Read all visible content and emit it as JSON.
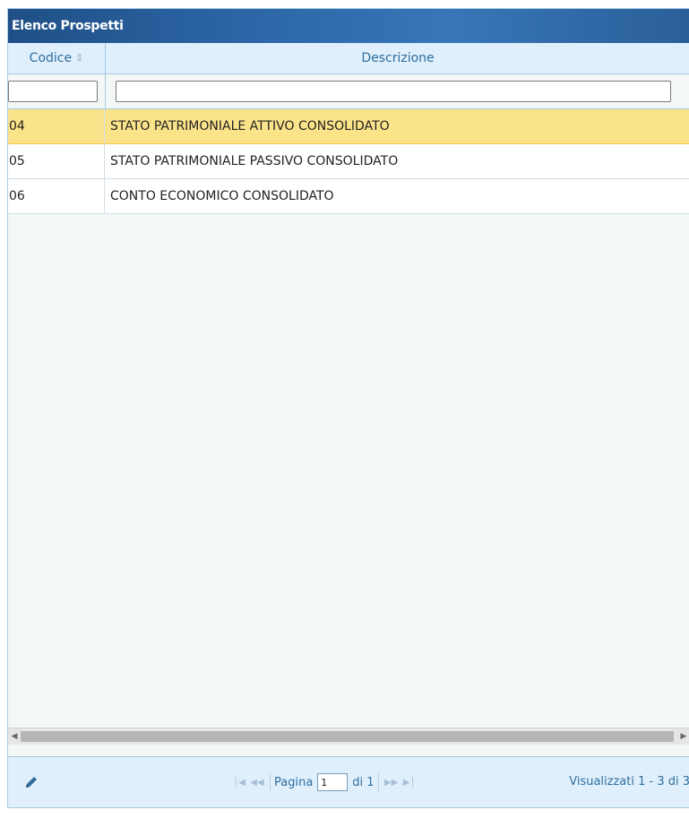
{
  "grid": {
    "title": "Elenco Prospetti",
    "columns": {
      "codice": "Codice",
      "descrizione": "Descrizione"
    },
    "filters": {
      "codice": "",
      "descrizione": ""
    },
    "rows": [
      {
        "codice": "04",
        "descrizione": "STATO PATRIMONIALE ATTIVO CONSOLIDATO",
        "selected": true
      },
      {
        "codice": "05",
        "descrizione": "STATO PATRIMONIALE PASSIVO CONSOLIDATO",
        "selected": false
      },
      {
        "codice": "06",
        "descrizione": "CONTO ECONOMICO CONSOLIDATO",
        "selected": false
      }
    ]
  },
  "pager": {
    "page_label": "Pagina",
    "page_value": "1",
    "of_label": "di 1",
    "records_info": "Visualizzati 1 - 3 di 3"
  },
  "icons": {
    "sort": "sort-icon",
    "edit": "pencil-icon",
    "first": "first-page-icon",
    "prev": "prev-page-icon",
    "next": "next-page-icon",
    "last": "last-page-icon"
  },
  "colors": {
    "title_bar": "#2c66a6",
    "header_bg": "#dfeffc",
    "selected_row": "#fbe38a",
    "border": "#a6c9e2"
  }
}
